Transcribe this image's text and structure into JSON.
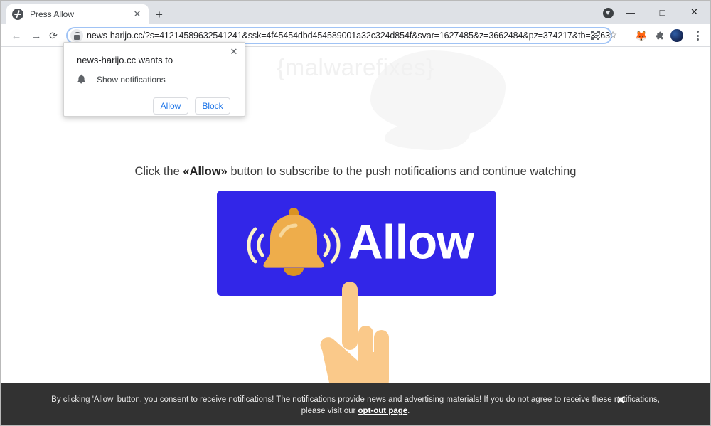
{
  "window": {
    "minimize_label": "—",
    "maximize_label": "□",
    "close_label": "✕",
    "download_icon": "download-circle-icon"
  },
  "tabs": [
    {
      "title": "Press Allow",
      "favicon": "globe-favicon",
      "close_label": "✕"
    }
  ],
  "newtab_label": "+",
  "toolbar": {
    "back_label": "←",
    "forward_label": "→",
    "reload_label": "⟳",
    "url": "news-harijo.cc/?s=41214589632541241&ssk=4f45454dbd454589001a32c324d854f&svar=1627485&z=3662484&pz=374217&tb=3263",
    "lock_icon": "lock-icon",
    "qr_icon": "qr-code-icon",
    "star_label": "☆",
    "fox_icon": "🦊",
    "puzzle_icon": "❖",
    "avatar_icon": "profile-avatar",
    "menu_icon": "three-dot-menu-icon"
  },
  "permission_popup": {
    "title": "news-harijo.cc wants to",
    "permission": "Show notifications",
    "bell_icon": "bell-icon",
    "allow_label": "Allow",
    "block_label": "Block",
    "close_label": "✕"
  },
  "page": {
    "watermark": "{malwarefixes}",
    "headline_prefix": "Click the ",
    "headline_bold": "«Allow»",
    "headline_suffix": " button to subscribe to the push notifications and continue watching",
    "allow_banner": {
      "label": "Allow",
      "bell_icon": "ringing-bell-icon",
      "hand_icon": "pointing-hand-icon",
      "background_color": "#3226e8",
      "bell_color": "#eead4b",
      "hand_color": "#fac98a"
    }
  },
  "consent_bar": {
    "text_line1": "By clicking 'Allow' button, you consent to receive notifications! The notifications provide news and advertising materials! If you do not agree to receive these notifications,",
    "text_line2_prefix": "please visit our ",
    "link_label": "opt-out page",
    "text_line2_suffix": ".",
    "close_label": "✕",
    "background_color": "#323232"
  }
}
